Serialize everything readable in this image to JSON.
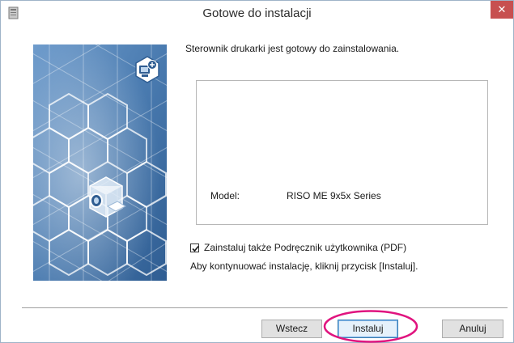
{
  "window": {
    "title": "Gotowe do instalacji",
    "close_icon": "close-icon",
    "app_icon": "installer-icon"
  },
  "side_panel": {
    "illustration": "hexagon-printer-network-illustration",
    "icons": [
      "computer-plus-icon",
      "printer-cube-icon"
    ]
  },
  "content": {
    "intro": "Sterownik drukarki jest gotowy do zainstalowania.",
    "model_label": "Model:",
    "model_value": "RISO ME 9x5x Series",
    "checkbox_label": "Zainstaluj także Podręcznik użytkownika (PDF)",
    "checkbox_checked": true,
    "continue_text": "Aby kontynuować instalację, kliknij przycisk [Instaluj]."
  },
  "buttons": {
    "back": "Wstecz",
    "install": "Instaluj",
    "cancel": "Anuluj"
  },
  "colors": {
    "close_button": "#c75050",
    "highlight_ellipse": "#e0147f",
    "panel_blue": "#4a7bb0"
  }
}
